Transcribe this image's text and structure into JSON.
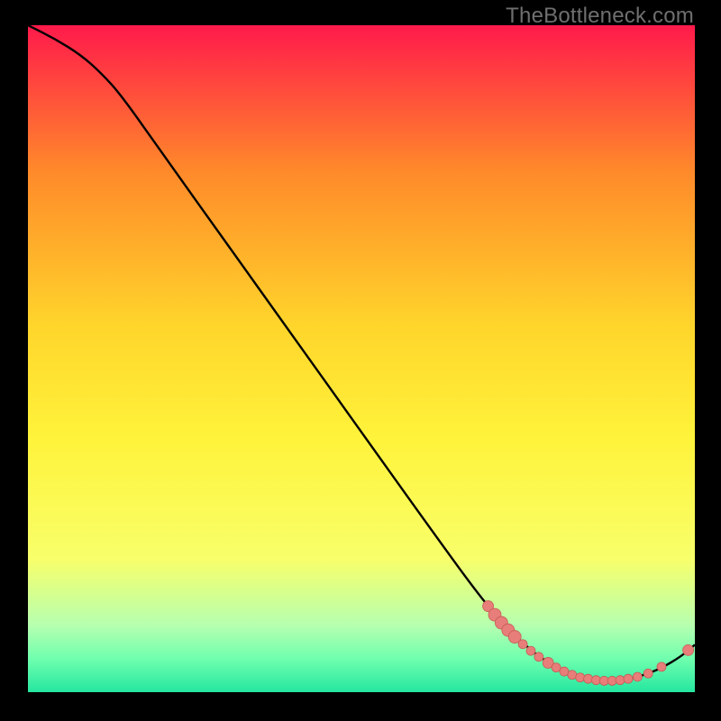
{
  "attribution": "TheBottleneck.com",
  "colors": {
    "page_bg": "#000000",
    "grad_top": "#ff1a4b",
    "grad_mid_upper": "#ff8a2a",
    "grad_mid": "#ffd52b",
    "grad_mid_lower": "#fff33b",
    "grad_low_yellow": "#f8ff6a",
    "grad_green_pale": "#b6ffb0",
    "grad_green_mid": "#6fffae",
    "grad_green_bottom": "#25e6a0",
    "curve": "#000000",
    "marker_fill": "#e77e7a",
    "marker_stroke": "#c85b56"
  },
  "chart_data": {
    "type": "line",
    "title": "",
    "xlabel": "",
    "ylabel": "",
    "xlim": [
      0,
      100
    ],
    "ylim": [
      0,
      100
    ],
    "grid": false,
    "curve": [
      {
        "x": 0,
        "y": 100
      },
      {
        "x": 4,
        "y": 98
      },
      {
        "x": 8,
        "y": 95.5
      },
      {
        "x": 11,
        "y": 92.8
      },
      {
        "x": 14,
        "y": 89.5
      },
      {
        "x": 20,
        "y": 81
      },
      {
        "x": 30,
        "y": 67
      },
      {
        "x": 40,
        "y": 53
      },
      {
        "x": 50,
        "y": 39
      },
      {
        "x": 60,
        "y": 25
      },
      {
        "x": 68,
        "y": 14
      },
      {
        "x": 72,
        "y": 9.5
      },
      {
        "x": 76,
        "y": 5.7
      },
      {
        "x": 80,
        "y": 3.3
      },
      {
        "x": 83,
        "y": 2.2
      },
      {
        "x": 86,
        "y": 1.8
      },
      {
        "x": 89,
        "y": 1.8
      },
      {
        "x": 92,
        "y": 2.4
      },
      {
        "x": 95,
        "y": 3.6
      },
      {
        "x": 98,
        "y": 5.4
      },
      {
        "x": 100,
        "y": 7.1
      }
    ],
    "markers": [
      {
        "x": 69.0,
        "y": 12.9,
        "r": 6
      },
      {
        "x": 70.0,
        "y": 11.6,
        "r": 7
      },
      {
        "x": 71.0,
        "y": 10.4,
        "r": 7
      },
      {
        "x": 72.0,
        "y": 9.3,
        "r": 7
      },
      {
        "x": 73.0,
        "y": 8.3,
        "r": 7
      },
      {
        "x": 74.2,
        "y": 7.2,
        "r": 5
      },
      {
        "x": 75.4,
        "y": 6.2,
        "r": 5
      },
      {
        "x": 76.6,
        "y": 5.3,
        "r": 5
      },
      {
        "x": 78.0,
        "y": 4.4,
        "r": 6
      },
      {
        "x": 79.2,
        "y": 3.7,
        "r": 5
      },
      {
        "x": 80.4,
        "y": 3.1,
        "r": 5
      },
      {
        "x": 81.6,
        "y": 2.6,
        "r": 5
      },
      {
        "x": 82.8,
        "y": 2.2,
        "r": 5
      },
      {
        "x": 84.0,
        "y": 2.0,
        "r": 5
      },
      {
        "x": 85.2,
        "y": 1.8,
        "r": 5
      },
      {
        "x": 86.4,
        "y": 1.7,
        "r": 5
      },
      {
        "x": 87.6,
        "y": 1.7,
        "r": 5
      },
      {
        "x": 88.8,
        "y": 1.8,
        "r": 5
      },
      {
        "x": 90.0,
        "y": 2.0,
        "r": 5
      },
      {
        "x": 91.4,
        "y": 2.3,
        "r": 5
      },
      {
        "x": 93.0,
        "y": 2.8,
        "r": 5
      },
      {
        "x": 95.0,
        "y": 3.8,
        "r": 5
      },
      {
        "x": 99.0,
        "y": 6.3,
        "r": 6
      }
    ]
  }
}
